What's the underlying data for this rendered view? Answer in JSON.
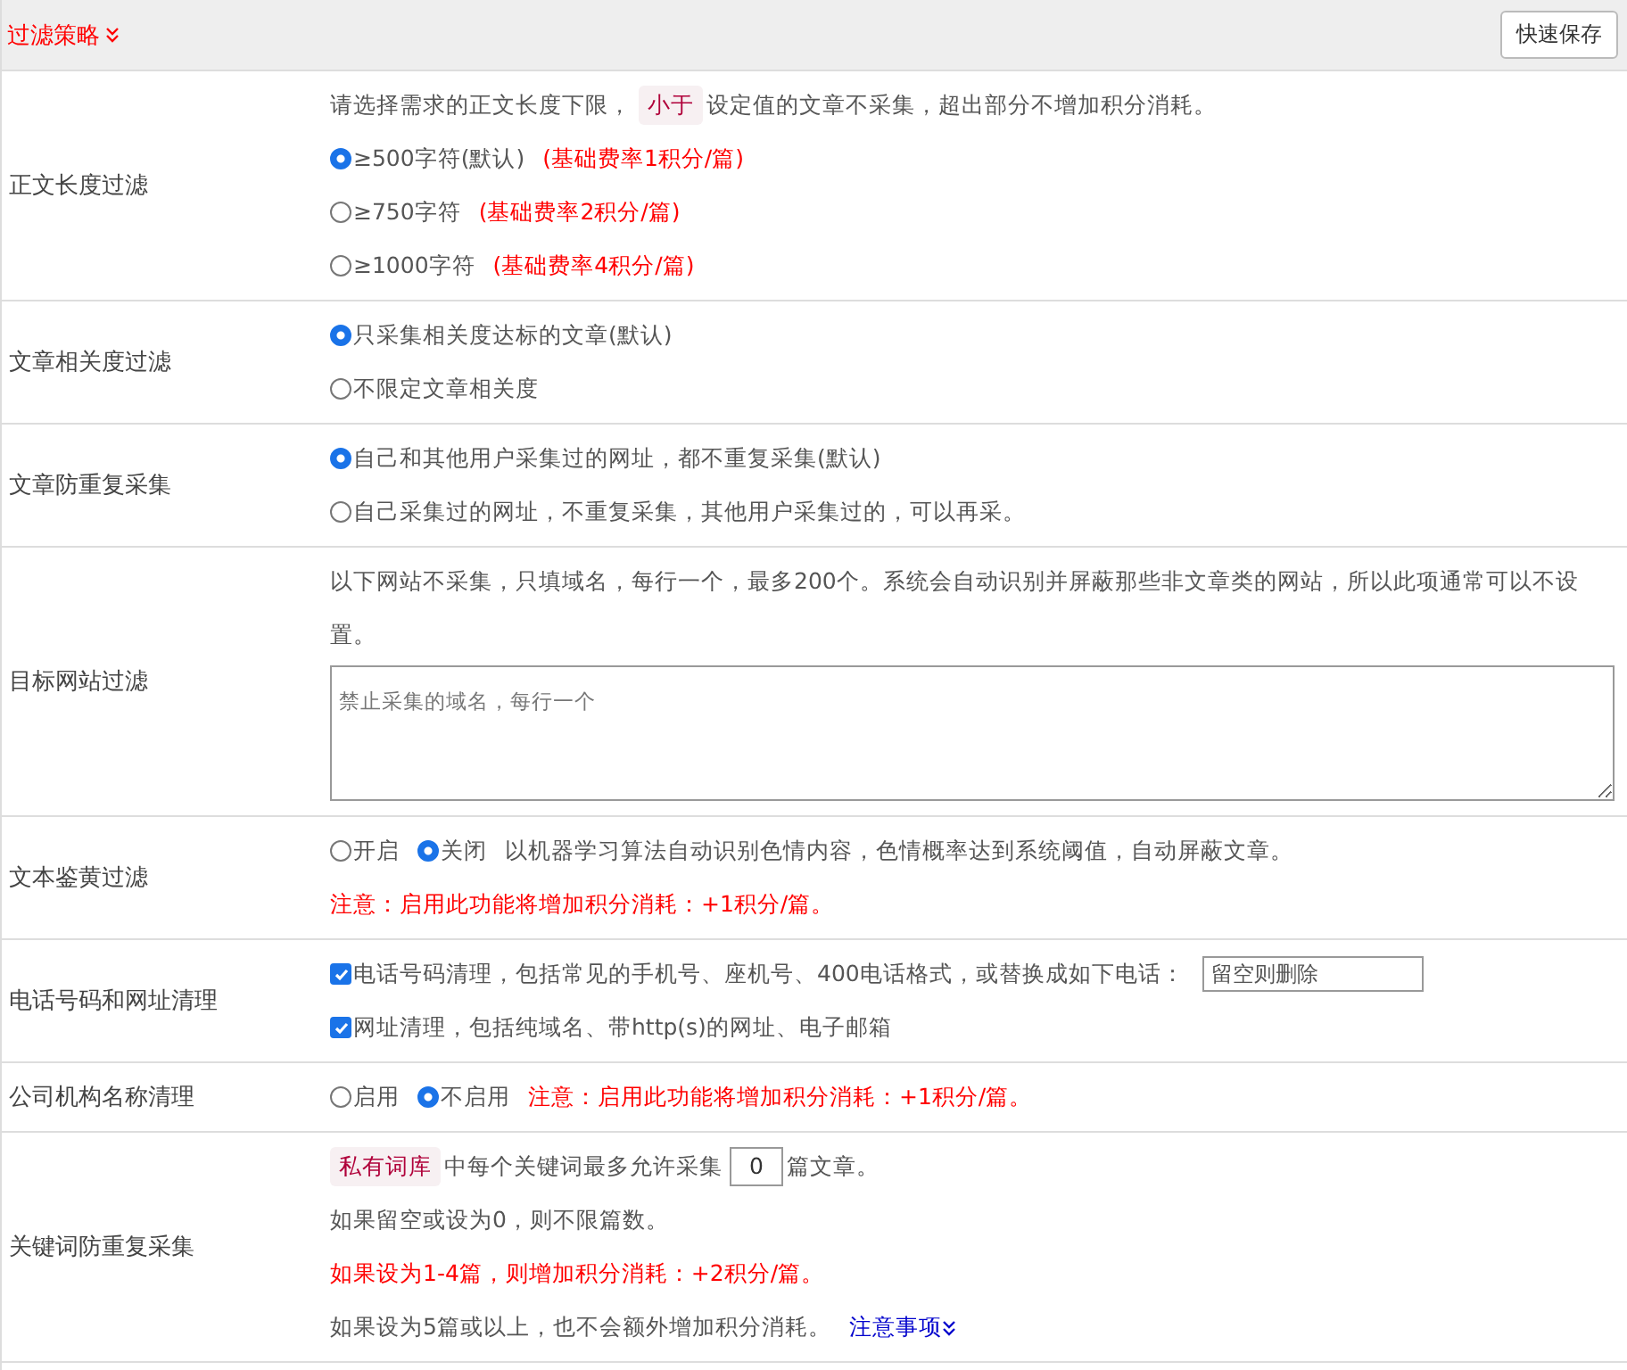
{
  "header": {
    "title": "过滤策略",
    "save_button": "快速保存"
  },
  "rows": [
    {
      "label": "正文长度过滤",
      "lines": [
        [
          {
            "kind": "text",
            "text": "请选择需求的正文长度下限，"
          },
          {
            "kind": "tag",
            "text": "小于"
          },
          {
            "kind": "text",
            "text": "设定值的文章不采集，超出部分不增加积分消耗。"
          }
        ],
        [
          {
            "kind": "radio",
            "text": "≥500字符(默认)",
            "selected": true
          },
          {
            "kind": "warn",
            "text": "(基础费率1积分/篇)"
          }
        ],
        [
          {
            "kind": "radio",
            "text": "≥750字符",
            "selected": false
          },
          {
            "kind": "warn",
            "text": "(基础费率2积分/篇)"
          }
        ],
        [
          {
            "kind": "radio",
            "text": "≥1000字符",
            "selected": false
          },
          {
            "kind": "warn",
            "text": "(基础费率4积分/篇)"
          }
        ]
      ]
    },
    {
      "label": "文章相关度过滤",
      "lines": [
        [
          {
            "kind": "radio",
            "text": "只采集相关度达标的文章(默认)",
            "selected": true
          }
        ],
        [
          {
            "kind": "radio",
            "text": "不限定文章相关度",
            "selected": false
          }
        ]
      ]
    },
    {
      "label": "文章防重复采集",
      "lines": [
        [
          {
            "kind": "radio",
            "text": "自己和其他用户采集过的网址，都不重复采集(默认)",
            "selected": true
          }
        ],
        [
          {
            "kind": "radio",
            "text": "自己采集过的网址，不重复采集，其他用户采集过的，可以再采。",
            "selected": false
          }
        ]
      ]
    },
    {
      "label": "目标网站过滤",
      "lines": [
        [
          {
            "kind": "text",
            "text": "以下网站不采集，只填域名，每行一个，最多200个。系统会自动识别并屏蔽那些非文章类的网站，所以此项通常可以不设置。"
          }
        ],
        [
          {
            "kind": "textarea",
            "placeholder": "禁止采集的域名，每行一个"
          }
        ]
      ]
    },
    {
      "label": "文本鉴黄过滤",
      "lines": [
        [
          {
            "kind": "radio",
            "text": "开启",
            "selected": false
          },
          {
            "kind": "radio",
            "text": "关闭",
            "selected": true
          },
          {
            "kind": "text",
            "text": "以机器学习算法自动识别色情内容，色情概率达到系统阈值，自动屏蔽文章。"
          }
        ],
        [
          {
            "kind": "warn",
            "text": "注意：启用此功能将增加积分消耗：+1积分/篇。"
          }
        ]
      ]
    },
    {
      "label": "电话号码和网址清理",
      "lines": [
        [
          {
            "kind": "checkbox",
            "text": "电话号码清理，包括常见的手机号、座机号、400电话格式，或替换成如下电话：",
            "checked": true
          },
          {
            "kind": "input",
            "placeholder": "留空则删除"
          }
        ],
        [
          {
            "kind": "checkbox",
            "text": "网址清理，包括纯域名、带http(s)的网址、电子邮箱",
            "checked": true
          }
        ]
      ]
    },
    {
      "label": "公司机构名称清理",
      "lines": [
        [
          {
            "kind": "radio",
            "text": "启用",
            "selected": false
          },
          {
            "kind": "radio",
            "text": "不启用",
            "selected": true
          },
          {
            "kind": "warn",
            "text": "注意：启用此功能将增加积分消耗：+1积分/篇。"
          }
        ]
      ]
    },
    {
      "label": "关键词防重复采集",
      "lines": [
        [
          {
            "kind": "tag",
            "text": "私有词库"
          },
          {
            "kind": "text",
            "text": "中每个关键词最多允许采集"
          },
          {
            "kind": "number",
            "value": "0"
          },
          {
            "kind": "text",
            "text": "篇文章。"
          }
        ],
        [
          {
            "kind": "text",
            "text": "如果留空或设为0，则不限篇数。"
          }
        ],
        [
          {
            "kind": "warn",
            "text": "如果设为1-4篇，则增加积分消耗：+2积分/篇。"
          }
        ],
        [
          {
            "kind": "text",
            "text": "如果设为5篇或以上，也不会额外增加积分消耗。"
          },
          {
            "kind": "link",
            "text": "注意事项"
          }
        ]
      ]
    }
  ]
}
